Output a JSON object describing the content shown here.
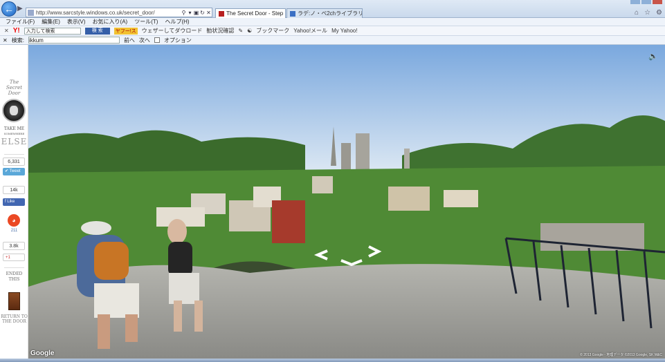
{
  "browser": {
    "address_url": "http://www.sarcstyle.windows.co.uk/secret_door/",
    "tabs": [
      {
        "label": "The Secret Door - Step ...",
        "active": true
      },
      {
        "label": "ラデ:ノ・ペ2chライブラリー",
        "active": false
      }
    ],
    "menu": [
      "ファイル(F)",
      "編集(E)",
      "表示(V)",
      "お気に入り(A)",
      "ツール(T)",
      "ヘルプ(H)"
    ],
    "toolbar": {
      "search_placeholder": "入力して検索",
      "search_button": "検 索",
      "yahoo_badge": "ヤフー!ス",
      "items": [
        "ウェザーしてダウロード",
        "勧状況確認",
        "ブックマーク",
        "Yahoo!メール",
        "My Yahoo!"
      ]
    },
    "findbar": {
      "label": "検索:",
      "input_value": "ikkum",
      "prev": "前へ",
      "next": "次へ",
      "options": "オプション"
    }
  },
  "sidebar": {
    "logo_line1": "The",
    "logo_line2": "Secret",
    "logo_line3": "Door",
    "take_me": "TAKE ME",
    "somewhere": "SOMEWHERE",
    "else": "ELSE",
    "share_count": "6,331",
    "tweet": "Tweet",
    "like_count": "14k",
    "like": "Like",
    "stumble_count": "211",
    "gplus_count": "3.8k",
    "gplus": "+1",
    "end_this": "ENDED THIS",
    "return_line1": "RETURN TO",
    "return_line2": "THE DOOR"
  },
  "pano": {
    "google": "Google",
    "copyright": "© 2013 Google - 地理データ ©2013 Google, SK M&C"
  },
  "colors": {
    "sky_top": "#7aa8de",
    "sky_bottom": "#e4edf5",
    "grass": "#4f8a35",
    "path": "#9b9b96",
    "accent_blue": "#1a63c2"
  }
}
